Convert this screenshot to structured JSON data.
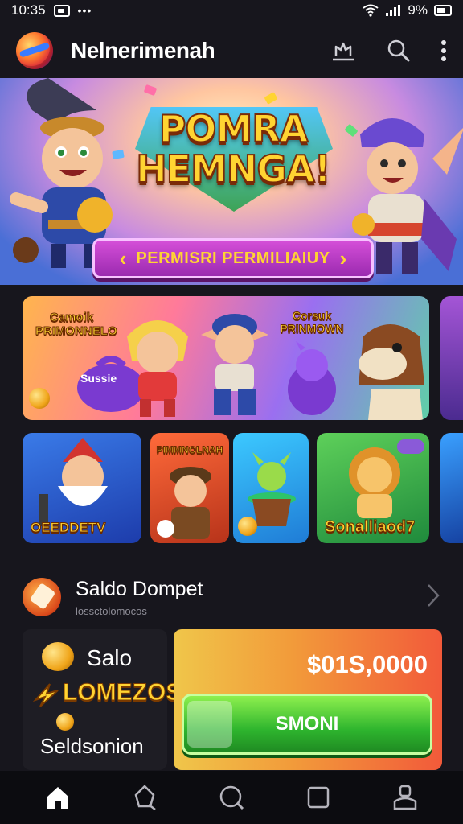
{
  "status_bar": {
    "time": "10:35",
    "battery": "9%",
    "icons": [
      "gallery-icon",
      "dots-icon",
      "wifi-icon",
      "signal-icon",
      "battery-icon"
    ]
  },
  "header": {
    "title": "Nelnerimenah",
    "logo_icon": "app-logo-icon",
    "actions": [
      "inbox-icon",
      "search-icon",
      "more-vertical-icon"
    ]
  },
  "hero": {
    "title": "POMRA HEMNGA!",
    "cta_label": "PERMISRI PERMILIAIUY",
    "colors": {
      "cta": "#b438c2",
      "title": "#ffd432"
    }
  },
  "game_cards": {
    "featured": {
      "labels": [
        "Camoik PRIMONNELO",
        "Sussie",
        "Corsuk PRINMOWN"
      ]
    },
    "row": [
      {
        "label": "OEEDDETV"
      },
      {
        "label": "PIMMNOLNAH"
      },
      {
        "label": ""
      },
      {
        "label": "Sonalliaod7"
      }
    ]
  },
  "wallet": {
    "title": "Saldo Dompet",
    "subtitle": "lossctolomocos",
    "chevron_icon": "chevron-right-icon"
  },
  "balance": {
    "label": "Salo",
    "bonus": "LOMEZOS!",
    "footer": "Seldsonion",
    "amount": "$01S,0000",
    "button_label": "SMONI",
    "colors": {
      "button": "#2eb52e",
      "panel": "#f29a3a"
    }
  },
  "bottom_nav": {
    "items": [
      "home-icon",
      "explore-icon",
      "search-icon",
      "square-icon",
      "profile-icon"
    ],
    "active": "home-icon"
  }
}
